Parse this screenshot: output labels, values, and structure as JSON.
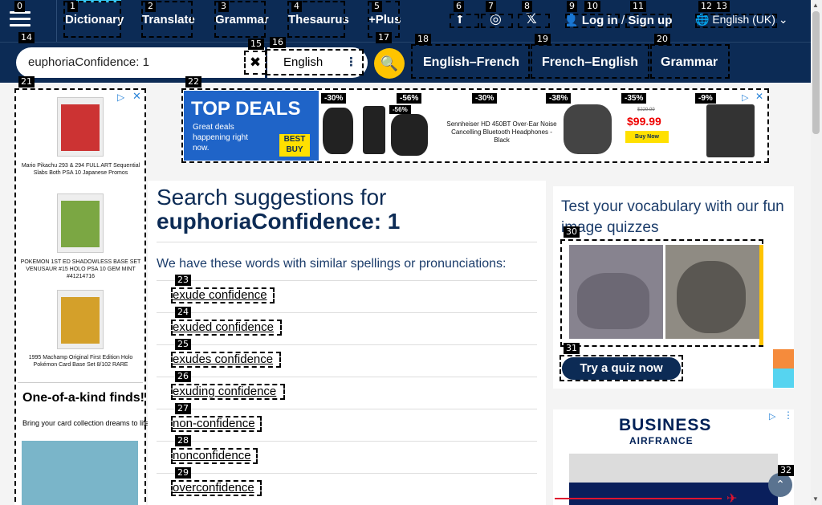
{
  "header": {
    "menu_icon": "hamburger-icon",
    "nav": [
      {
        "label": "Dictionary"
      },
      {
        "label": "Translate"
      },
      {
        "label": "Grammar"
      },
      {
        "label": "Thesaurus"
      },
      {
        "label": "+Plus"
      }
    ],
    "social": [
      {
        "icon": "facebook-icon",
        "glyph": "f"
      },
      {
        "icon": "instagram-icon",
        "glyph": "◎"
      },
      {
        "icon": "x-icon",
        "glyph": "𝕏"
      }
    ],
    "login_label": "Log in",
    "separator": "/",
    "signup_label": "Sign up",
    "language_label": "English (UK)",
    "accent_color": "#35c7f2",
    "bg_color": "#0c2b55"
  },
  "search": {
    "value": "euphoriaConfidence: 1",
    "clear_glyph": "✖",
    "dictionary_label": "English",
    "tabs": [
      {
        "label": "English–French"
      },
      {
        "label": "French–English"
      },
      {
        "label": "Grammar"
      }
    ],
    "button_color": "#fec400"
  },
  "marker_labels": [
    "0",
    "1",
    "2",
    "3",
    "4",
    "5",
    "6",
    "7",
    "8",
    "9",
    "10",
    "11",
    "12",
    "13",
    "14",
    "15",
    "16",
    "17",
    "18",
    "19",
    "20",
    "21",
    "22",
    "23",
    "24",
    "25",
    "26",
    "27",
    "28",
    "29",
    "30",
    "31",
    "32"
  ],
  "left_ad": {
    "items": [
      {
        "text": "Mario Pikachu 293 & 294 FULL ART Sequential Slabs Both PSA 10 Japanese Promos"
      },
      {
        "text": "POKEMON 1ST ED SHADOWLESS BASE SET VENUSAUR #15 HOLO PSA 10 GEM MINT #41214716"
      },
      {
        "text": "1995 Machamp Original First Edition Holo Pokémon Card Base Set 8/102 RARE"
      }
    ],
    "promo_title": "One-of-a-kind finds!",
    "promo_sub": "Bring your card collection dreams to life."
  },
  "banner_ad": {
    "title": "TOP DEALS",
    "subtitle": "Great deals happening right now.",
    "logo": "BEST BUY",
    "discounts": [
      "-30%",
      "-56%",
      "-56%",
      "-30%",
      "-38%",
      "-35%",
      "-9%"
    ],
    "product_text": "Sennheiser HD 450BT Over-Ear Noise Cancelling Bluetooth Headphones - Black",
    "old_price": "$229.99",
    "price": "$99.99",
    "buy_label": "Buy Now"
  },
  "main": {
    "heading_prefix": "Search suggestions for",
    "heading_term": "euphoriaConfidence: 1",
    "intro": "We have these words with similar spellings or pronunciations:",
    "suggestions": [
      "exude confidence",
      "exuded confidence",
      "exudes confidence",
      "exuding confidence",
      "non-confidence",
      "nonconfidence",
      "overconfidence"
    ]
  },
  "quiz": {
    "title": "Test your vocabulary with our fun image quizzes",
    "button_label": "Try a quiz now"
  },
  "airfrance_ad": {
    "line1": "BUSINESS",
    "line2": "AIRFRANCE"
  }
}
